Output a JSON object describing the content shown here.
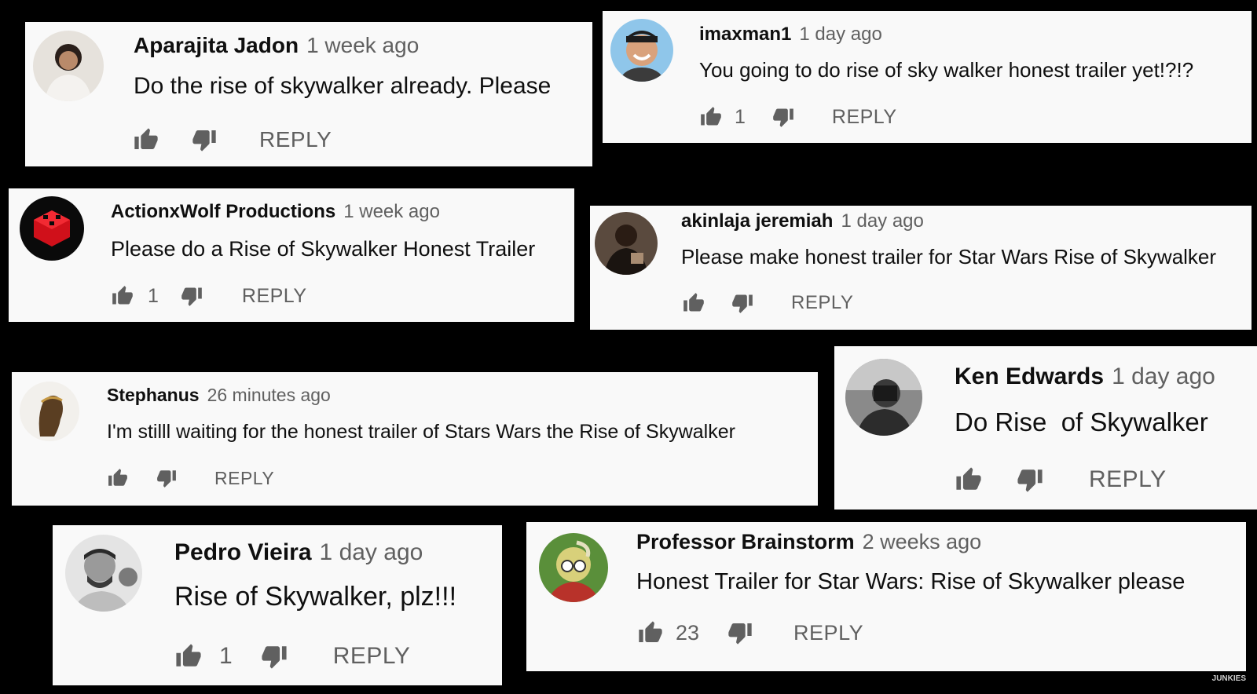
{
  "reply_label": "REPLY",
  "watermark": "JUNKIES",
  "comments": [
    {
      "author": "Aparajita Jadon",
      "time": "1 week ago",
      "text": "Do the rise of skywalker already. Please",
      "likes": ""
    },
    {
      "author": "imaxman1",
      "time": "1 day ago",
      "text": "You going to do rise of sky walker honest trailer yet!?!?",
      "likes": "1"
    },
    {
      "author": "ActionxWolf Productions",
      "time": "1 week ago",
      "text": "Please do a Rise of Skywalker Honest Trailer",
      "likes": "1"
    },
    {
      "author": "akinlaja jeremiah",
      "time": "1 day ago",
      "text": "Please make honest trailer for Star Wars Rise of Skywalker",
      "likes": ""
    },
    {
      "author": "Stephanus",
      "time": "26 minutes ago",
      "text": "I'm stilll waiting for the honest trailer of Stars Wars the Rise of Skywalker",
      "likes": ""
    },
    {
      "author": "Ken Edwards",
      "time": "1 day ago",
      "text": "Do Rise  of Skywalker",
      "likes": ""
    },
    {
      "author": "Pedro Vieira",
      "time": "1 day ago",
      "text": "Rise of Skywalker, plz!!!",
      "likes": "1"
    },
    {
      "author": "Professor Brainstorm",
      "time": "2 weeks ago",
      "text": "Honest Trailer for Star Wars: Rise of Skywalker please",
      "likes": "23"
    }
  ]
}
